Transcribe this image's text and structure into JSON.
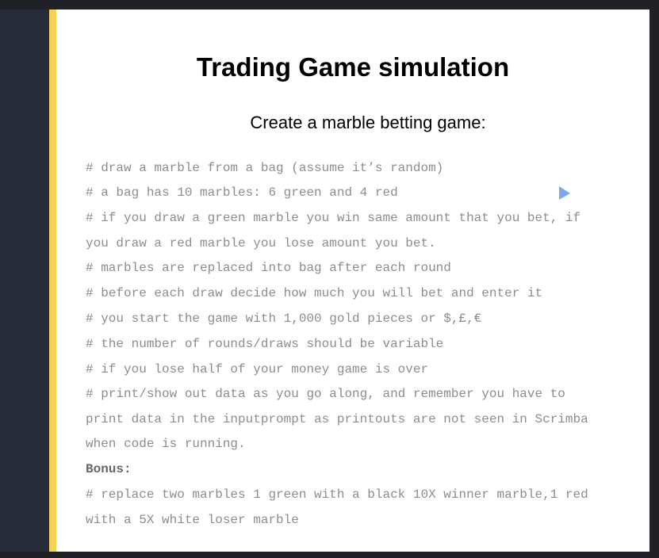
{
  "slide": {
    "title": "Trading Game simulation",
    "subtitle": "Create a marble betting game:",
    "lines": [
      "# draw a marble from a bag (assume it’s random)",
      "# a bag has 10 marbles: 6 green and 4 red",
      "# if you draw a green marble you win same amount that you bet, if",
      "you draw a red marble you lose amount you bet.",
      "# marbles are replaced into bag after each round",
      "# before each draw decide how much you will bet and enter it",
      "# you start the game with 1,000 gold pieces or $,£,€",
      "# the number of rounds/draws should be variable",
      "# if you lose half of your money game is over",
      "# print/show out data as you go along, and remember you have to",
      "print data in the inputprompt as printouts are not seen in Scrimba",
      "when code is running.",
      "Bonus:",
      "# replace two marbles 1 green with a black 10X winner marble,1 red",
      "with a 5X white loser marble"
    ]
  },
  "colors": {
    "accent": "#f7d257",
    "panel": "#262b38",
    "code_text": "#8d8d8d",
    "cursor": "#7fa6f0"
  },
  "icons": {
    "cursor": "pointer-cursor-icon"
  }
}
